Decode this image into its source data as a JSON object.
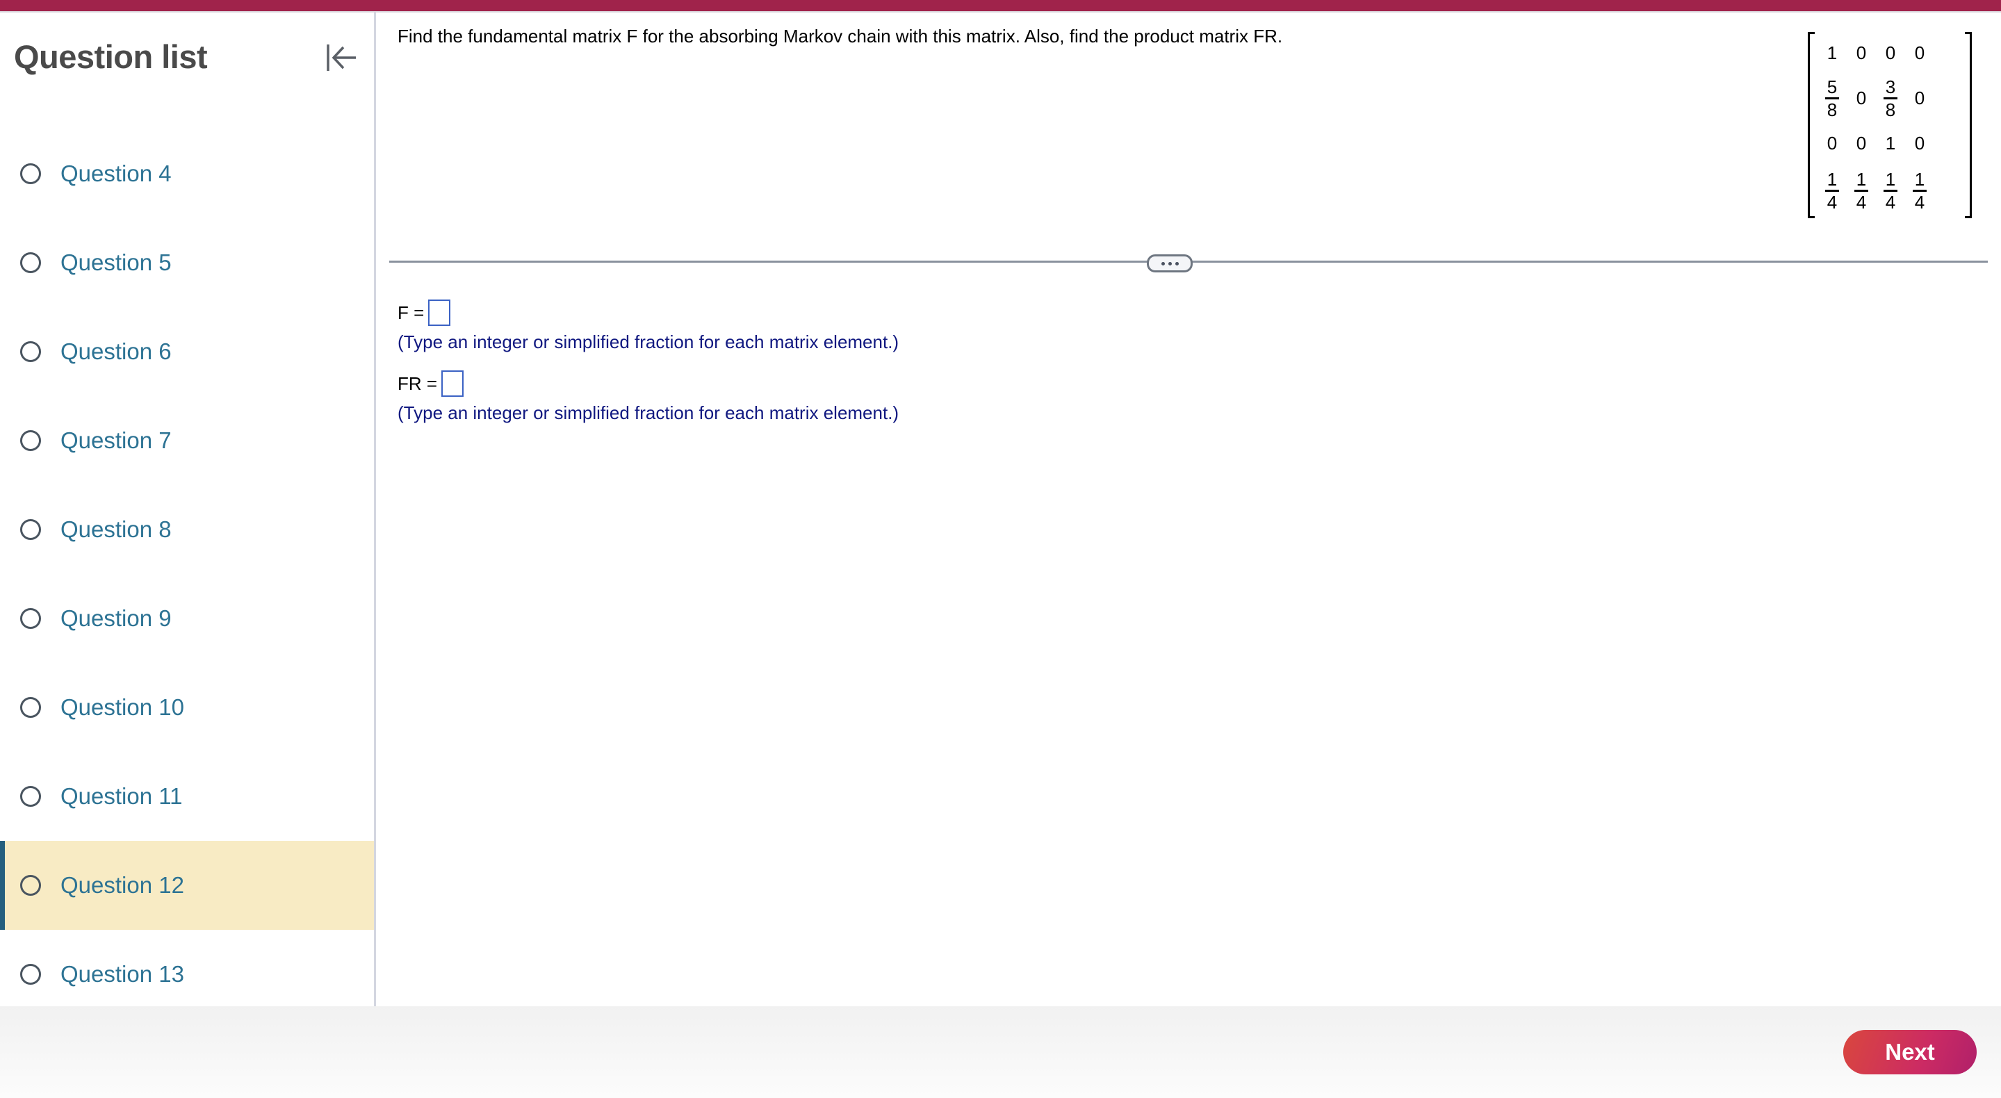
{
  "header": {
    "brand_color": "#a0234b"
  },
  "sidebar": {
    "title": "Question list",
    "collapse_icon": "collapse-left-icon",
    "active_index": 8,
    "items": [
      {
        "label": "Question 4",
        "status": "unanswered"
      },
      {
        "label": "Question 5",
        "status": "unanswered"
      },
      {
        "label": "Question 6",
        "status": "unanswered"
      },
      {
        "label": "Question 7",
        "status": "unanswered"
      },
      {
        "label": "Question 8",
        "status": "unanswered"
      },
      {
        "label": "Question 9",
        "status": "unanswered"
      },
      {
        "label": "Question 10",
        "status": "unanswered"
      },
      {
        "label": "Question 11",
        "status": "unanswered"
      },
      {
        "label": "Question 12",
        "status": "unanswered"
      },
      {
        "label": "Question 13",
        "status": "unanswered"
      }
    ]
  },
  "question": {
    "text": "Find the fundamental matrix F for the absorbing Markov chain with this matrix. Also, find the product matrix FR.",
    "matrix": [
      [
        {
          "v": "1"
        },
        {
          "v": "0"
        },
        {
          "v": "0"
        },
        {
          "v": "0"
        }
      ],
      [
        {
          "n": "5",
          "d": "8"
        },
        {
          "v": "0"
        },
        {
          "n": "3",
          "d": "8"
        },
        {
          "v": "0"
        }
      ],
      [
        {
          "v": "0"
        },
        {
          "v": "0"
        },
        {
          "v": "1"
        },
        {
          "v": "0"
        }
      ],
      [
        {
          "n": "1",
          "d": "4"
        },
        {
          "n": "1",
          "d": "4"
        },
        {
          "n": "1",
          "d": "4"
        },
        {
          "n": "1",
          "d": "4"
        }
      ]
    ],
    "expand_icon": "more-dots-icon"
  },
  "answers": [
    {
      "label": "F =",
      "value": "",
      "hint": "(Type an integer or simplified fraction for each matrix element.)"
    },
    {
      "label": "FR =",
      "value": "",
      "hint": "(Type an integer or simplified fraction for each matrix element.)"
    }
  ],
  "footer": {
    "next_label": "Next"
  }
}
